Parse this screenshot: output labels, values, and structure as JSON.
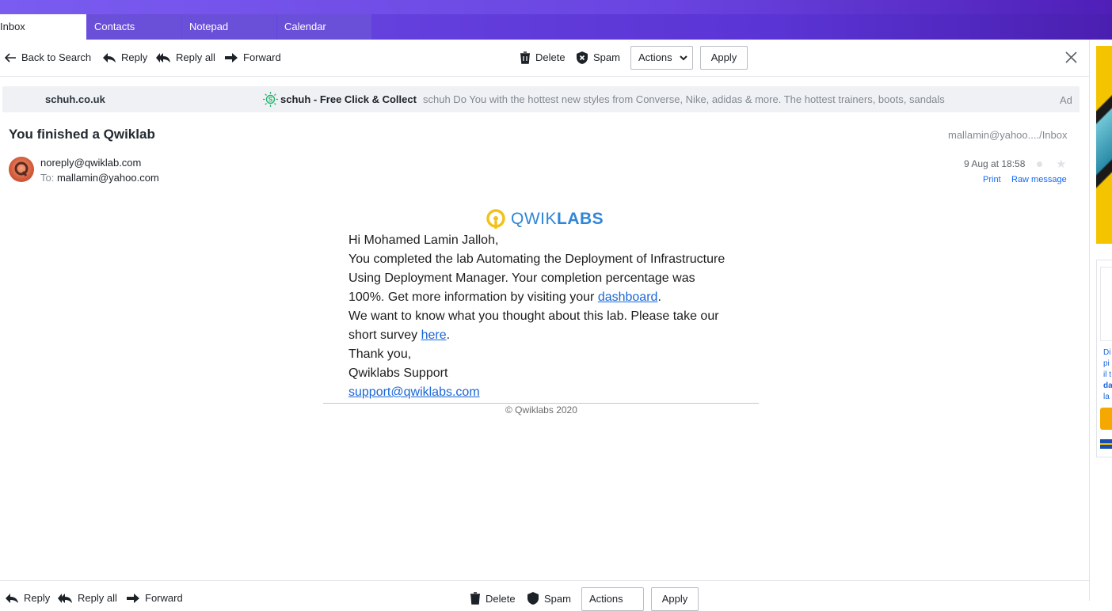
{
  "tabs": [
    {
      "label": "Inbox"
    },
    {
      "label": "Contacts"
    },
    {
      "label": "Notepad"
    },
    {
      "label": "Calendar"
    }
  ],
  "toolbar": {
    "back": "Back to Search",
    "reply": "Reply",
    "reply_all": "Reply all",
    "forward": "Forward",
    "delete": "Delete",
    "spam": "Spam",
    "actions": "Actions",
    "apply": "Apply"
  },
  "ad": {
    "advertiser": "schuh.co.uk",
    "title": "schuh - Free Click & Collect",
    "text": "schuh Do You with the hottest new styles from Converse, Nike, adidas & more. The hottest trainers, boots, sandals",
    "label": "Ad"
  },
  "message": {
    "subject": "You finished a Qwiklab",
    "folder": "mallamin@yahoo..../Inbox",
    "from": "noreply@qwiklab.com",
    "to_label": "To:",
    "to": "mallamin@yahoo.com",
    "date": "9 Aug at 18:58",
    "print": "Print",
    "raw": "Raw message"
  },
  "email_body": {
    "logo_light": "QWIK",
    "logo_bold": "LABS",
    "greeting": "Hi Mohamed Lamin Jalloh,",
    "p1_a": "You completed the lab Automating the Deployment of Infrastructure Using Deployment Manager. Your completion percentage was 100%. Get more information by visiting your ",
    "p1_link": "dashboard",
    "p1_end": ".",
    "p2_a": "We want to know what you thought about this lab. Please take our short survey ",
    "p2_link": "here",
    "p2_end": ".",
    "thanks": "Thank you,",
    "signature": "Qwiklabs Support",
    "support_email": "support@qwiklabs.com",
    "copyright": "© Qwiklabs 2020"
  },
  "right_ad": {
    "lines": [
      "Di",
      "pi",
      "il t",
      "da",
      "la"
    ]
  },
  "colors": {
    "accent": "#6a44e0",
    "link": "#0f69ff",
    "logo_blue": "#2f86d9",
    "logo_yellow": "#f2c21b"
  }
}
